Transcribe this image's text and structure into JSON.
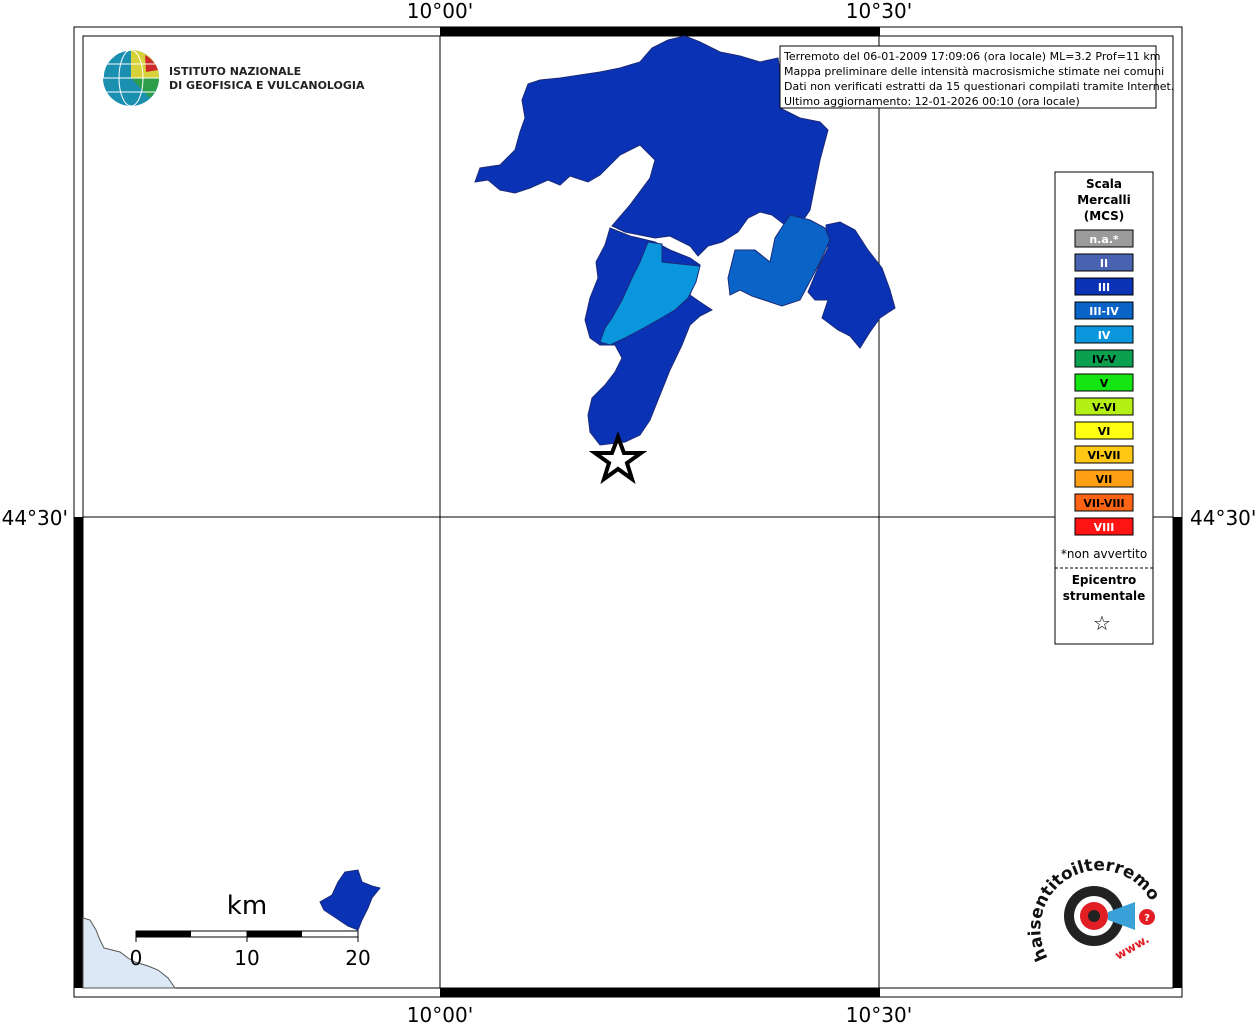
{
  "map": {
    "coordinates": {
      "lon_left": "10°00'",
      "lon_right": "10°30'",
      "lat_mid": "44°30'"
    },
    "info_box": {
      "lines": [
        "Terremoto del 06-01-2009 17:09:06 (ora locale) ML=3.2 Prof=11 km",
        "Mappa preliminare delle intensità macrosismiche stimate nei comuni",
        "Dati non verificati estratti da 15 questionari compilati tramite Internet.",
        "Ultimo aggiornamento: 12-01-2026 00:10 (ora locale)"
      ]
    },
    "logo_ingv": {
      "line1": "ISTITUTO NAZIONALE",
      "line2": "DI GEOFISICA E VULCANOLOGIA"
    },
    "legend": {
      "title_lines": [
        "Scala",
        "Mercalli",
        "(MCS)"
      ],
      "items": [
        {
          "label": "n.a.*",
          "color": "#9b9b9b",
          "text_color": "#ffffff"
        },
        {
          "label": "II",
          "color": "#4a63b0",
          "text_color": "#ffffff"
        },
        {
          "label": "III",
          "color": "#0a32b4",
          "text_color": "#ffffff"
        },
        {
          "label": "III-IV",
          "color": "#0a64c8",
          "text_color": "#ffffff"
        },
        {
          "label": "IV",
          "color": "#0a96dc",
          "text_color": "#ffffff"
        },
        {
          "label": "IV-V",
          "color": "#0aa050",
          "text_color": "#000000"
        },
        {
          "label": "V",
          "color": "#14e614",
          "text_color": "#000000"
        },
        {
          "label": "V-VI",
          "color": "#b4f014",
          "text_color": "#000000"
        },
        {
          "label": "VI",
          "color": "#ffff14",
          "text_color": "#000000"
        },
        {
          "label": "VI-VII",
          "color": "#ffc814",
          "text_color": "#000000"
        },
        {
          "label": "VII",
          "color": "#ffa014",
          "text_color": "#000000"
        },
        {
          "label": "VII-VIII",
          "color": "#ff6414",
          "text_color": "#000000"
        },
        {
          "label": "VIII",
          "color": "#ff1414",
          "text_color": "#ffffff"
        }
      ],
      "footnote": "*non avvertito",
      "epicenter_lines": [
        "Epicentro",
        "strumentale"
      ],
      "epicenter_symbol": "☆"
    },
    "scale_bar": {
      "unit": "km",
      "ticks": [
        "0",
        "10",
        "20"
      ]
    },
    "logo_hsit": {
      "text": "haisentitoilterremoto.it",
      "url_text": "www."
    },
    "colors": {
      "intensity_III": "#0a32b4",
      "intensity_III_IV": "#0a64c8",
      "intensity_IV": "#0a96dc",
      "sea": "#dce8f5"
    }
  }
}
